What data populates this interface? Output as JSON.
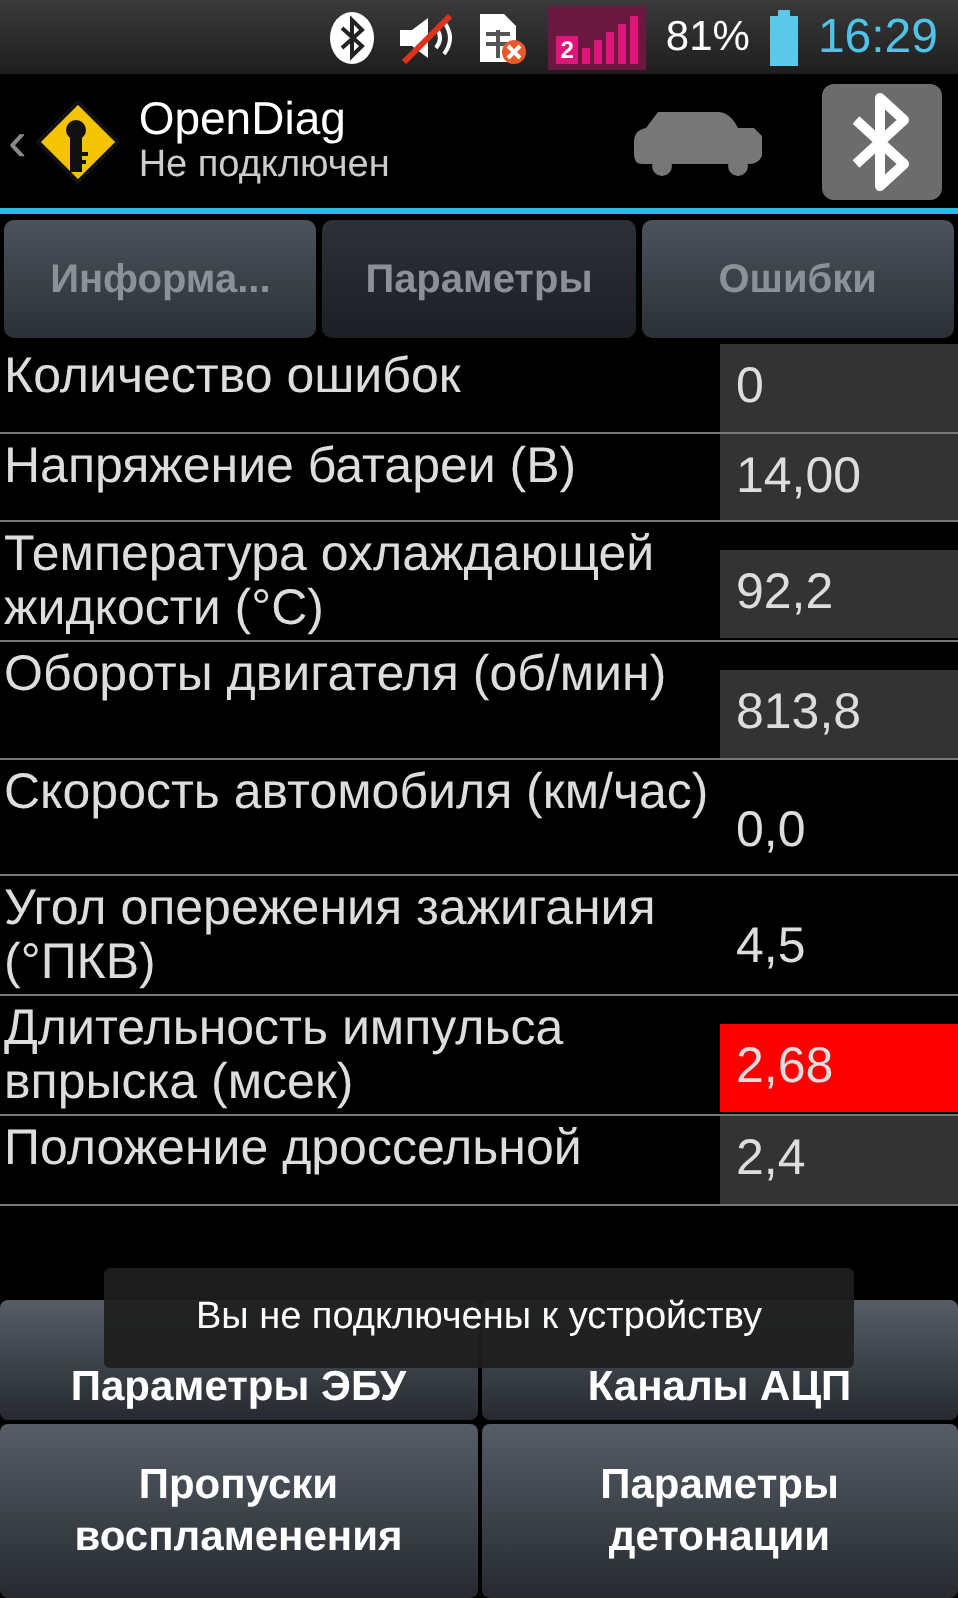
{
  "status_bar": {
    "battery": "81%",
    "time": "16:29",
    "signal_sim": "2"
  },
  "app_bar": {
    "back": "‹",
    "title": "OpenDiag",
    "subtitle": "Не подключен"
  },
  "tabs": [
    {
      "label": "Информа...",
      "selected": false
    },
    {
      "label": "Параметры",
      "selected": true
    },
    {
      "label": "Ошибки",
      "selected": false
    }
  ],
  "parameters": [
    {
      "name": "Количество ошибок",
      "value": "0",
      "color": "#333333"
    },
    {
      "name": "Напряжение батареи (В)",
      "value": "14,00",
      "color": "#333333"
    },
    {
      "name": "Температура охлаждающей жидкости (°C)",
      "value": "92,2",
      "color": "#333333"
    },
    {
      "name": "Обороты двигателя (об/мин)",
      "value": "813,8",
      "color": "#333333"
    },
    {
      "name": "Скорость автомобиля (км/час)",
      "value": "0,0",
      "color": "#000000"
    },
    {
      "name": "Угол опережения зажигания (°ПКВ)",
      "value": "4,5",
      "color": "#000000"
    },
    {
      "name": "Длительность импульса впрыска (мсек)",
      "value": "2,68",
      "color": "#ff0000"
    },
    {
      "name": "Положение дроссельной",
      "value": "2,4",
      "color": "#333333"
    }
  ],
  "buttons": [
    "Параметры ЭБУ",
    "Каналы АЦП",
    "Пропуски воспламенения",
    "Параметры детонации"
  ],
  "toast": "Вы не подключены к устройству"
}
